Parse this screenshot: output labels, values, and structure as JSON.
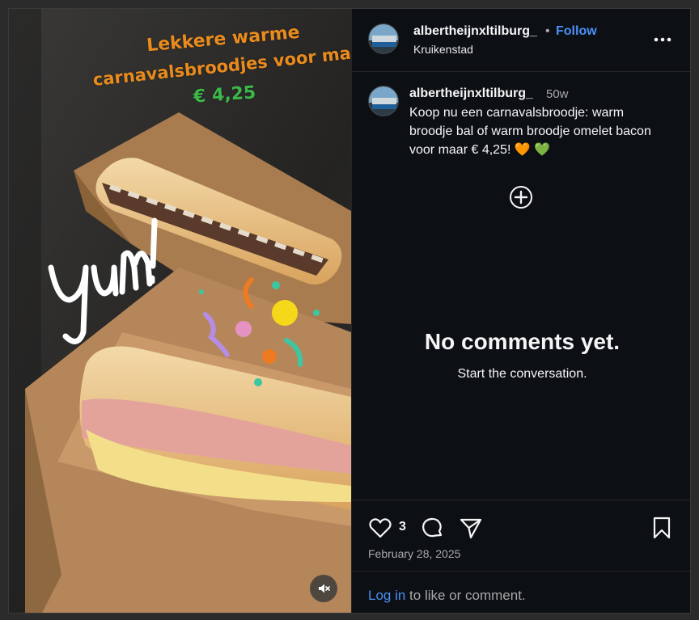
{
  "media": {
    "story_lines": [
      "Lekkere warme",
      "carnavalsbroodjes voor maar",
      "€ 4,25"
    ],
    "sticker_text": "yum!",
    "mute_icon": "speaker-muted-icon"
  },
  "header": {
    "username": "albertheijnxltilburg_",
    "separator": "•",
    "follow_label": "Follow",
    "location": "Kruikenstad",
    "more_icon": "more-horizontal-icon"
  },
  "caption": {
    "username": "albertheijnxltilburg_",
    "time": "50w",
    "text": "Koop nu een carnavalsbroodje: warm broodje bal of warm broodje omelet bacon voor maar € 4,25! 🧡 💚"
  },
  "comments": {
    "empty_title": "No comments yet.",
    "empty_subtitle": "Start the conversation."
  },
  "actions": {
    "like_count": "3",
    "date": "February 28, 2025"
  },
  "footer": {
    "login_label": "Log in",
    "suffix": " to like or comment."
  },
  "colors": {
    "accent": "#4a90f5",
    "background": "#0c0f14",
    "story_orange": "#e98b1d",
    "story_green": "#3cb84a"
  }
}
